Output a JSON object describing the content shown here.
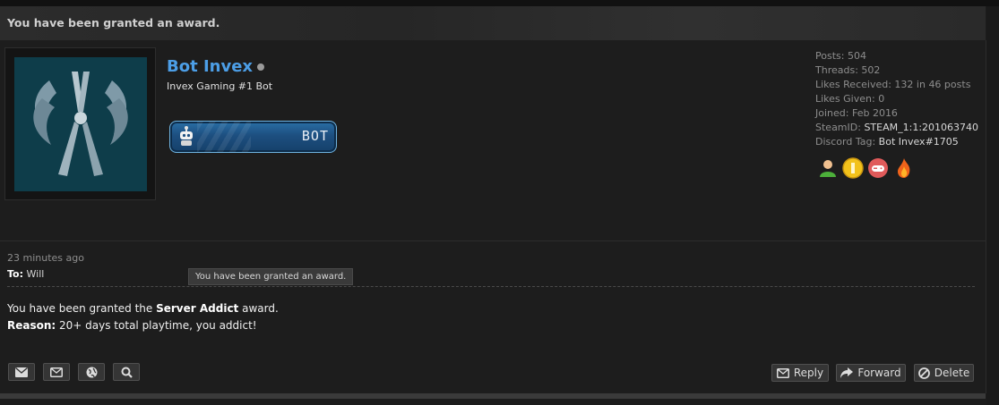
{
  "header": {
    "title": "You have been granted an award."
  },
  "profile": {
    "username": "Bot Invex",
    "user_title": "Invex Gaming #1 Bot",
    "rank_label": "BOT",
    "stats": [
      {
        "label": "Posts:",
        "value": "504"
      },
      {
        "label": "Threads:",
        "value": "502"
      },
      {
        "label": "Likes Received:",
        "value": "132 in 46 posts"
      },
      {
        "label": "Likes Given:",
        "value": "0"
      },
      {
        "label": "Joined:",
        "value": "Feb 2016"
      },
      {
        "label": "SteamID:",
        "value": "STEAM_1:1:201063740"
      },
      {
        "label": "Discord Tag:",
        "value": "Bot Invex#1705"
      }
    ],
    "award_icons": [
      "user-green-icon",
      "gold-coin-icon",
      "gamepad-icon",
      "fire-icon"
    ]
  },
  "message": {
    "time": "23 minutes ago",
    "to_label": "To:",
    "to_value": "Will",
    "tooltip": "You have been granted an award.",
    "line1_prefix": "You have been granted the ",
    "line1_award": "Server Addict",
    "line1_suffix": " award.",
    "line2_label": "Reason:",
    "line2_text": " 20+ days total playtime, you addict!"
  },
  "actions": {
    "left_icons": [
      "envelope-filled-icon",
      "envelope-outline-icon",
      "globe-icon",
      "search-icon"
    ],
    "reply": "Reply",
    "forward": "Forward",
    "delete": "Delete"
  },
  "colors": {
    "username": "#4c9ee6",
    "panel_bg": "#1d1d1d",
    "avatar_bg": "#0e3d4a",
    "rank_blue": "#1d4f80"
  }
}
